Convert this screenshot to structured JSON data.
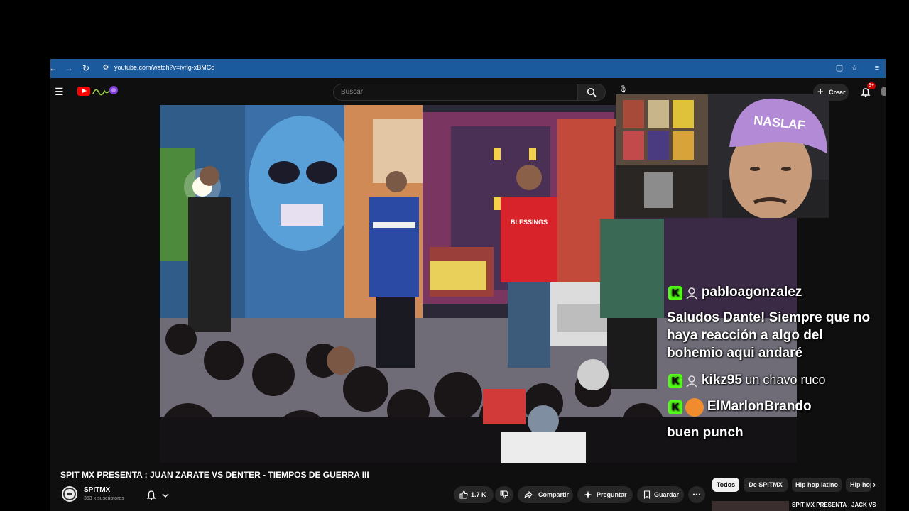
{
  "browser": {
    "url": "youtube.com/watch?v=ivrlg-xBMCo"
  },
  "header": {
    "search_placeholder": "Buscar",
    "create_label": "Crear",
    "notification_badge": "9+"
  },
  "chat": [
    {
      "user": "pabloagonzalez",
      "message": "Saludos Dante! Siempre que no haya reacción a algo del bohemio aqui andaré"
    },
    {
      "user": "kikz95",
      "message": "un chavo ruco"
    },
    {
      "user": "ElMarlonBrando",
      "message": "buen punch"
    }
  ],
  "video": {
    "title": "SPIT MX PRESENTA : JUAN ZARATE VS DENTER - TIEMPOS DE GUERRA III",
    "shirt_text": "BLESSINGS"
  },
  "channel": {
    "name": "SPITMX",
    "subscribers": "353 k suscriptores"
  },
  "actions": {
    "likes": "1.7 K",
    "share": "Compartir",
    "ask": "Preguntar",
    "save": "Guardar"
  },
  "chips": [
    "Todos",
    "De SPITMX",
    "Hip hop latino",
    "Hip hop"
  ],
  "related": {
    "title": "SPIT MX PRESENTA : JACK VS"
  },
  "colors": {
    "address_bar": "#1c5a9e",
    "youtube_red": "#ff0000",
    "kick_green": "#53fc18",
    "page_bg": "#0f0f0f"
  }
}
